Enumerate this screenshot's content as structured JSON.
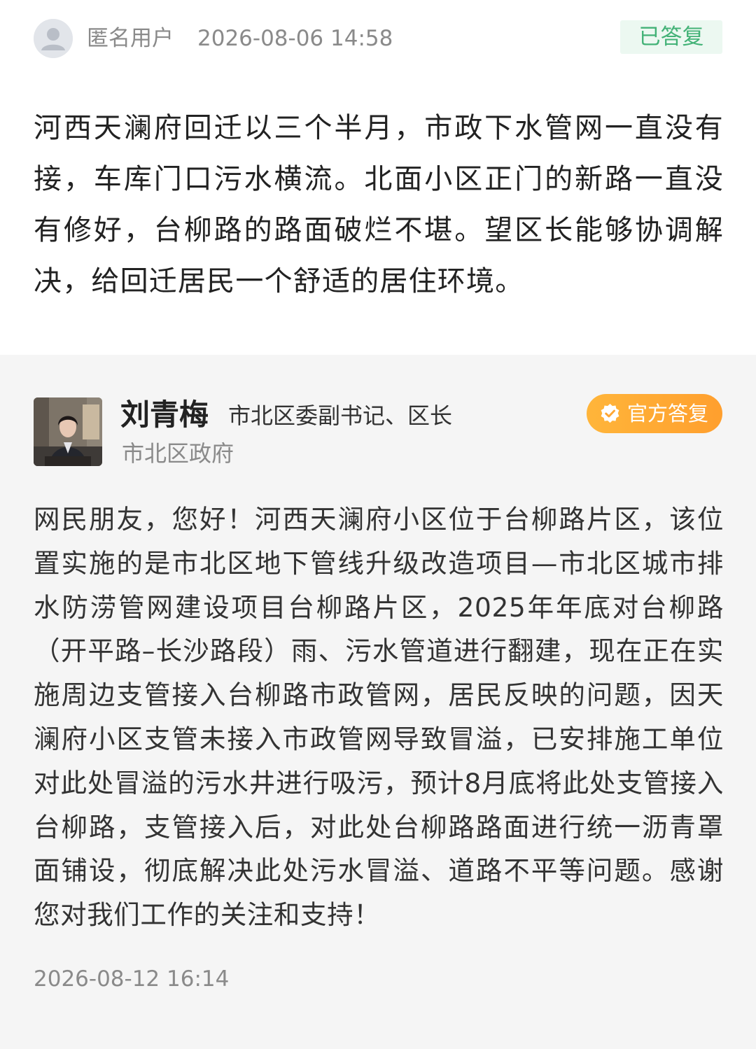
{
  "question": {
    "author": "匿名用户",
    "timestamp": "2026-08-06 14:58",
    "status": "已答复",
    "content": "河西天澜府回迁以三个半月，市政下水管网一直没有接，车库门口污水横流。北面小区正门的新路一直没有修好，台柳路的路面破烂不堪。望区长能够协调解决，给回迁居民一个舒适的居住环境。"
  },
  "reply": {
    "official_name": "刘青梅",
    "official_title": "市北区委副书记、区长",
    "organization": "市北区政府",
    "badge": "官方答复",
    "content": "网民朋友，您好！河西天澜府小区位于台柳路片区，该位置实施的是市北区地下管线升级改造项目—市北区城市排水防涝管网建设项目台柳路片区，2025年年底对台柳路（开平路–长沙路段）雨、污水管道进行翻建，现在正在实施周边支管接入台柳路市政管网，居民反映的问题，因天澜府小区支管未接入市政管网导致冒溢，已安排施工单位对此处冒溢的污水井进行吸污，预计8月底将此处支管接入台柳路，支管接入后，对此处台柳路路面进行统一沥青罩面铺设，彻底解决此处污水冒溢、道路不平等问题。感谢您对我们工作的关注和支持！",
    "timestamp": "2026-08-12 16:14"
  },
  "colors": {
    "status_green": "#43b277",
    "status_bg": "#ecf8f1",
    "badge_orange": "#ffa733",
    "reply_bg": "#f5f5f5"
  },
  "icons": {
    "question_avatar": "default-user-avatar-icon",
    "official_badge": "verified-check-icon"
  }
}
